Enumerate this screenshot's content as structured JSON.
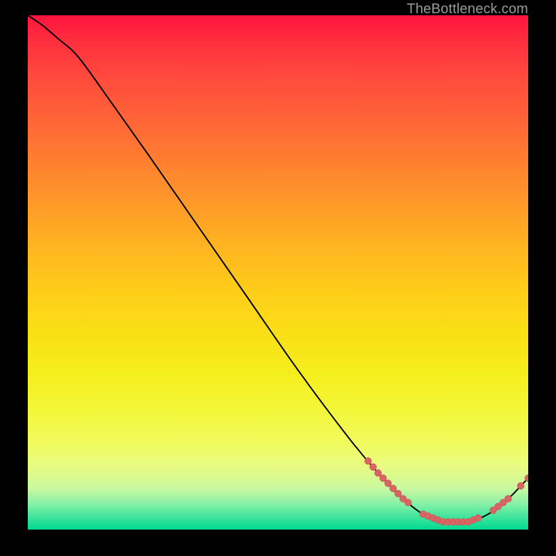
{
  "watermark": "TheBottleneck.com",
  "colors": {
    "curve_stroke": "#000000",
    "marker_fill": "#d66563",
    "marker_stroke": "#c44f4d"
  },
  "chart_data": {
    "type": "line",
    "title": "",
    "xlabel": "",
    "ylabel": "",
    "xlim": [
      0,
      100
    ],
    "ylim": [
      0,
      100
    ],
    "curve": [
      {
        "x": 0,
        "y": 100
      },
      {
        "x": 3,
        "y": 98
      },
      {
        "x": 6,
        "y": 95.5
      },
      {
        "x": 10,
        "y": 92
      },
      {
        "x": 16,
        "y": 84
      },
      {
        "x": 24,
        "y": 73
      },
      {
        "x": 34,
        "y": 59
      },
      {
        "x": 44,
        "y": 45
      },
      {
        "x": 54,
        "y": 31
      },
      {
        "x": 64,
        "y": 18
      },
      {
        "x": 70,
        "y": 11
      },
      {
        "x": 75,
        "y": 6
      },
      {
        "x": 79,
        "y": 3
      },
      {
        "x": 83,
        "y": 1.5
      },
      {
        "x": 88,
        "y": 1.5
      },
      {
        "x": 92,
        "y": 3
      },
      {
        "x": 96,
        "y": 6
      },
      {
        "x": 99,
        "y": 9
      },
      {
        "x": 100,
        "y": 10
      }
    ],
    "marker_clusters": [
      {
        "x_start": 68,
        "x_end": 76,
        "count": 9,
        "radius": 5
      },
      {
        "x_start": 79,
        "x_end": 90,
        "count": 12,
        "radius": 5
      },
      {
        "x_start": 93,
        "x_end": 96,
        "count": 4,
        "radius": 5
      },
      {
        "x_start": 98.5,
        "x_end": 100,
        "count": 2,
        "radius": 5
      }
    ]
  }
}
